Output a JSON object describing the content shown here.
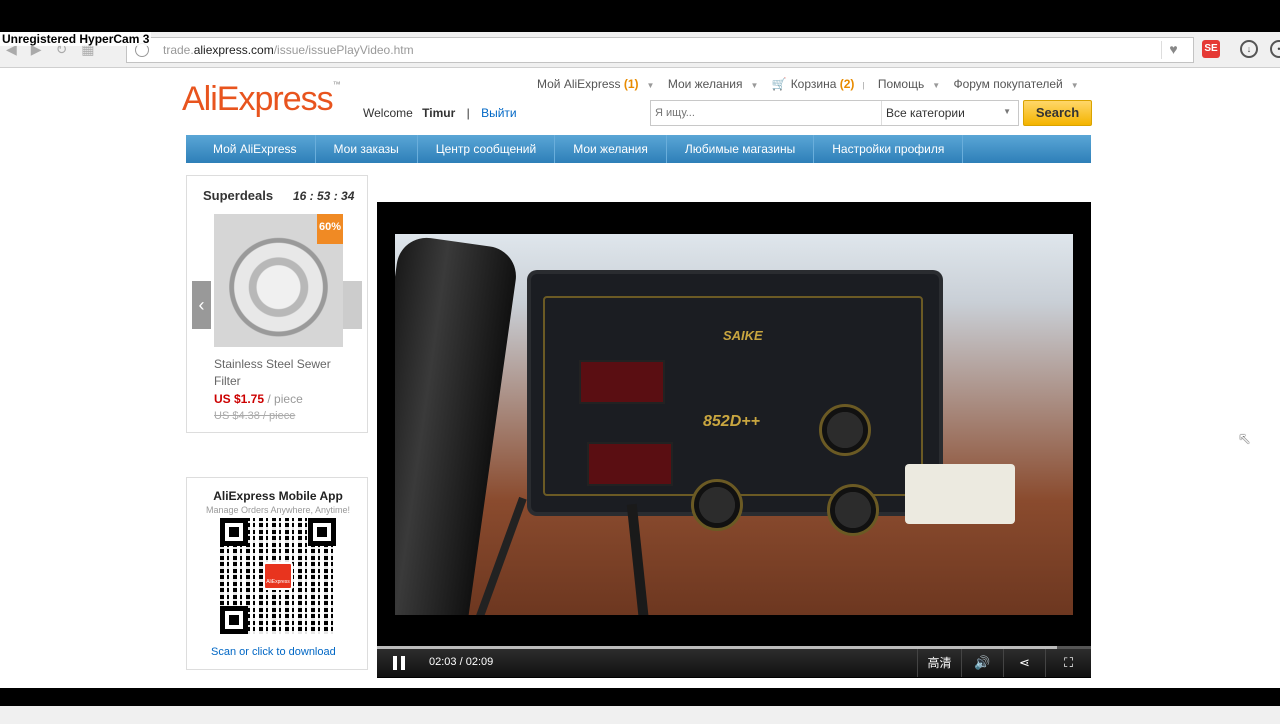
{
  "watermark": "Unregistered HyperCam 3",
  "browser": {
    "url_prefix": "trade.",
    "url_domain": "aliexpress.com",
    "url_path": "/issue/issuePlayVideo.htm"
  },
  "header": {
    "logo": "AliExpress",
    "welcome_label": "Welcome",
    "user_name": "Timur",
    "separator": "|",
    "logout_label": "Выйти",
    "top_links": {
      "my_aliexpress": "Мой AliExpress",
      "my_aliexpress_count": "(1)",
      "wishlist": "Мои желания",
      "cart": "Корзина",
      "cart_count": "(2)",
      "help": "Помощь",
      "forum": "Форум покупателей"
    },
    "search": {
      "placeholder": "Я ищу...",
      "category": "Все категории",
      "button": "Search"
    }
  },
  "navbar": {
    "items": [
      "Мой AliExpress",
      "Мои заказы",
      "Центр сообщений",
      "Мои желания",
      "Любимые магазины",
      "Настройки профиля"
    ]
  },
  "superdeals": {
    "title": "Superdeals",
    "countdown": "16 : 53 : 34",
    "badge": "60%",
    "product_name": "Stainless Steel Sewer Filter",
    "price": "US $1.75",
    "price_unit": "/ piece",
    "old_price": "US $4.38 / piece"
  },
  "mobile_app": {
    "title": "AliExpress Mobile App",
    "subtitle": "Manage Orders Anywhere, Anytime!",
    "qr_label": "AliExpress",
    "download_link": "Scan or click to download"
  },
  "player": {
    "video_brand": "SAIKE",
    "video_model": "852D++",
    "current_time": "02:03",
    "time_separator": "/",
    "total_time": "02:09",
    "progress_fraction": 0.953,
    "hd_label": "高清"
  }
}
